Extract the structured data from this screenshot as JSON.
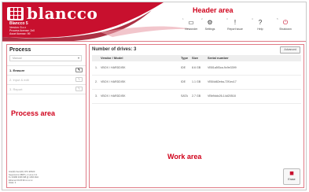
{
  "header": {
    "logo_text": "blancco",
    "info_lines": [
      "Blancco 5",
      "Version: 5.x.x",
      "Process license: 2x0",
      "Asset license: 99"
    ],
    "area_label": "Header area",
    "toolbar": [
      {
        "num": "1",
        "icon": "monitor-icon",
        "glyph": "▭",
        "label": "Viewonder"
      },
      {
        "num": "2",
        "icon": "gear-icon",
        "glyph": "⚙",
        "label": "Settings"
      },
      {
        "num": "3",
        "icon": "report-icon",
        "glyph": "!",
        "label": "Report issue"
      },
      {
        "num": "4",
        "icon": "help-icon",
        "glyph": "?",
        "label": "Help"
      },
      {
        "num": "5",
        "icon": "power-icon",
        "glyph": "⏻",
        "label": "Shutdown"
      }
    ]
  },
  "process": {
    "title": "Process",
    "select_value": "Manual",
    "steps": [
      {
        "label": "1. Erasure",
        "active": true
      },
      {
        "label": "2. Input & edit",
        "active": false
      },
      {
        "label": "3. Report",
        "active": false
      }
    ],
    "area_label": "Process area",
    "footer_lines": [
      "Intel(R) Xeon(R) CPU E5620",
      "Supermicro X8DTL-i / Linux 3.2",
      "8 x DIMM 4096 MB @ 1066 MHz",
      "Ethernet 00:25:90:xx:xx:xx",
      "Disks: 3"
    ]
  },
  "work": {
    "drives_title": "Number of drives: 3",
    "advanced_label": "Advanced",
    "columns": {
      "vendor": "Vendor / Model",
      "type": "Type",
      "size": "Size",
      "serial": "Serial number"
    },
    "rows": [
      {
        "idx": "1.",
        "vendor": "VBOX / HARDDISK",
        "type": "IDE",
        "size": "8.6 GB",
        "serial": "VB51a5f3ca-9c9e3399"
      },
      {
        "idx": "2.",
        "vendor": "VBOX / HARDDISK",
        "type": "IDE",
        "size": "1.1 GB",
        "serial": "VB54d82eba-72f1ec17"
      },
      {
        "idx": "3.",
        "vendor": "VBOX / HARDDISK",
        "type": "SATA",
        "size": "2.7 GB",
        "serial": "VBb9ddc26-14d20518"
      }
    ],
    "area_label": "Work area",
    "erase_label": "Erase"
  },
  "colors": {
    "brand_red": "#c8102e",
    "annotation_red": "#d0021b"
  }
}
